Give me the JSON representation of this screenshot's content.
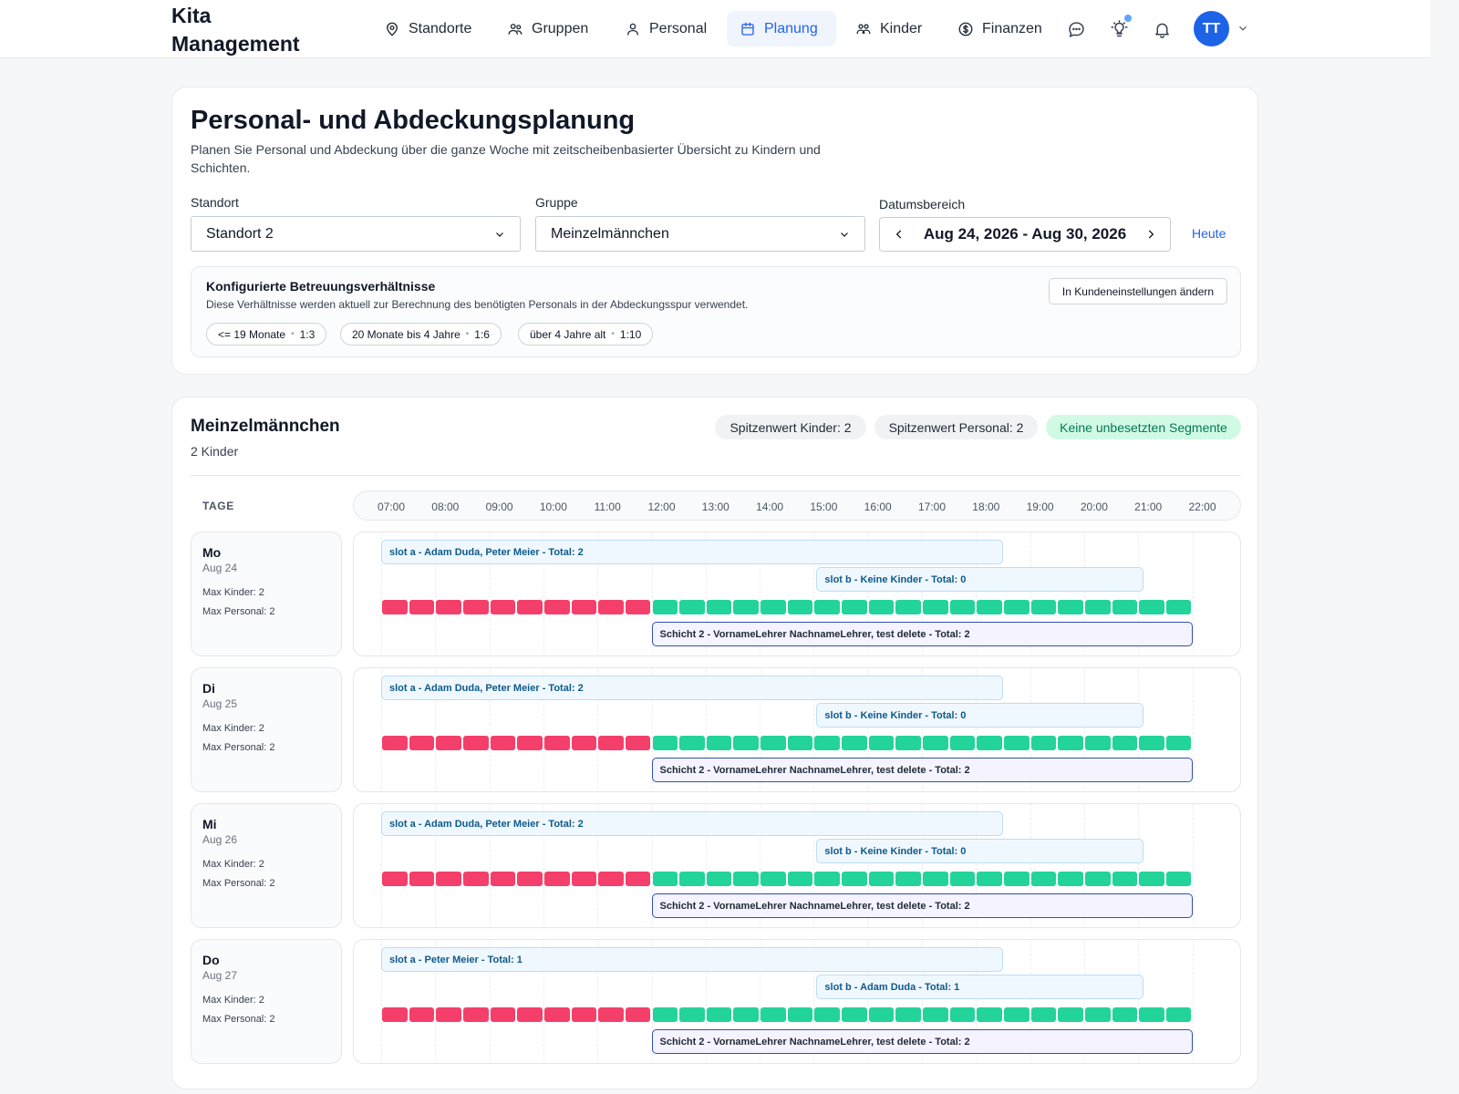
{
  "app": {
    "title": "Kita Management"
  },
  "nav": {
    "items": [
      {
        "id": "standorte",
        "label": "Standorte",
        "icon": "map-pin-icon",
        "active": false
      },
      {
        "id": "gruppen",
        "label": "Gruppen",
        "icon": "users-icon",
        "active": false
      },
      {
        "id": "personal",
        "label": "Personal",
        "icon": "user-icon",
        "active": false
      },
      {
        "id": "planung",
        "label": "Planung",
        "icon": "calendar-icon",
        "active": true
      },
      {
        "id": "kinder",
        "label": "Kinder",
        "icon": "children-icon",
        "active": false
      },
      {
        "id": "finanzen",
        "label": "Finanzen",
        "icon": "dollar-icon",
        "active": false
      }
    ],
    "avatar_initials": "TT"
  },
  "header": {
    "title": "Personal- und Abdeckungsplanung",
    "subtitle": "Planen Sie Personal und Abdeckung über die ganze Woche mit zeitscheibenbasierter Übersicht zu Kindern und Schichten."
  },
  "filters": {
    "standort_label": "Standort",
    "standort_value": "Standort 2",
    "gruppe_label": "Gruppe",
    "gruppe_value": "Meinzelmännchen",
    "date_label": "Datumsbereich",
    "date_value": "Aug 24, 2026 - Aug 30, 2026",
    "today_label": "Heute"
  },
  "ratios": {
    "title": "Konfigurierte Betreuungsverhältnisse",
    "description": "Diese Verhältnisse werden aktuell zur Berechnung des benötigten Personals in der Abdeckungsspur verwendet.",
    "edit_button": "In Kundeneinstellungen ändern",
    "items": [
      {
        "age": "<= 19 Monate",
        "ratio": "1:3"
      },
      {
        "age": "20 Monate bis 4 Jahre",
        "ratio": "1:6"
      },
      {
        "age": "über 4 Jahre alt",
        "ratio": "1:10"
      }
    ]
  },
  "group": {
    "name": "Meinzelmännchen",
    "children_count": "2 Kinder",
    "peak_children": "Spitzenwert Kinder: 2",
    "peak_staff": "Spitzenwert Personal: 2",
    "status": "Keine unbesetzten Segmente"
  },
  "timeline": {
    "days_header": "TAGE",
    "hours": [
      "07:00",
      "08:00",
      "09:00",
      "10:00",
      "11:00",
      "12:00",
      "13:00",
      "14:00",
      "15:00",
      "16:00",
      "17:00",
      "18:00",
      "19:00",
      "20:00",
      "21:00",
      "22:00"
    ],
    "coverage": {
      "uncovered_from": "07:00",
      "uncovered_to": "12:00",
      "covered_from": "12:00",
      "covered_to": "22:00"
    },
    "days": [
      {
        "name": "Mo",
        "date": "Aug 24",
        "max_kinder": "Max Kinder: 2",
        "max_personal": "Max Personal: 2",
        "slot_a": "slot a - Adam Duda, Peter Meier - Total: 2",
        "slot_b": "slot b - Keine Kinder - Total: 0",
        "shift": "Schicht 2 - VornameLehrer NachnameLehrer, test delete - Total: 2"
      },
      {
        "name": "Di",
        "date": "Aug 25",
        "max_kinder": "Max Kinder: 2",
        "max_personal": "Max Personal: 2",
        "slot_a": "slot a - Adam Duda, Peter Meier - Total: 2",
        "slot_b": "slot b - Keine Kinder - Total: 0",
        "shift": "Schicht 2 - VornameLehrer NachnameLehrer, test delete - Total: 2"
      },
      {
        "name": "Mi",
        "date": "Aug 26",
        "max_kinder": "Max Kinder: 2",
        "max_personal": "Max Personal: 2",
        "slot_a": "slot a - Adam Duda, Peter Meier - Total: 2",
        "slot_b": "slot b - Keine Kinder - Total: 0",
        "shift": "Schicht 2 - VornameLehrer NachnameLehrer, test delete - Total: 2"
      },
      {
        "name": "Do",
        "date": "Aug 27",
        "max_kinder": "Max Kinder: 2",
        "max_personal": "Max Personal: 2",
        "slot_a": "slot a - Peter Meier - Total: 1",
        "slot_b": "slot b - Adam Duda - Total: 1",
        "shift": "Schicht 2 - VornameLehrer NachnameLehrer, test delete - Total: 2"
      }
    ]
  },
  "colors": {
    "accent": "#2563eb",
    "uncovered": "#f43f6a",
    "covered": "#22d39a"
  }
}
